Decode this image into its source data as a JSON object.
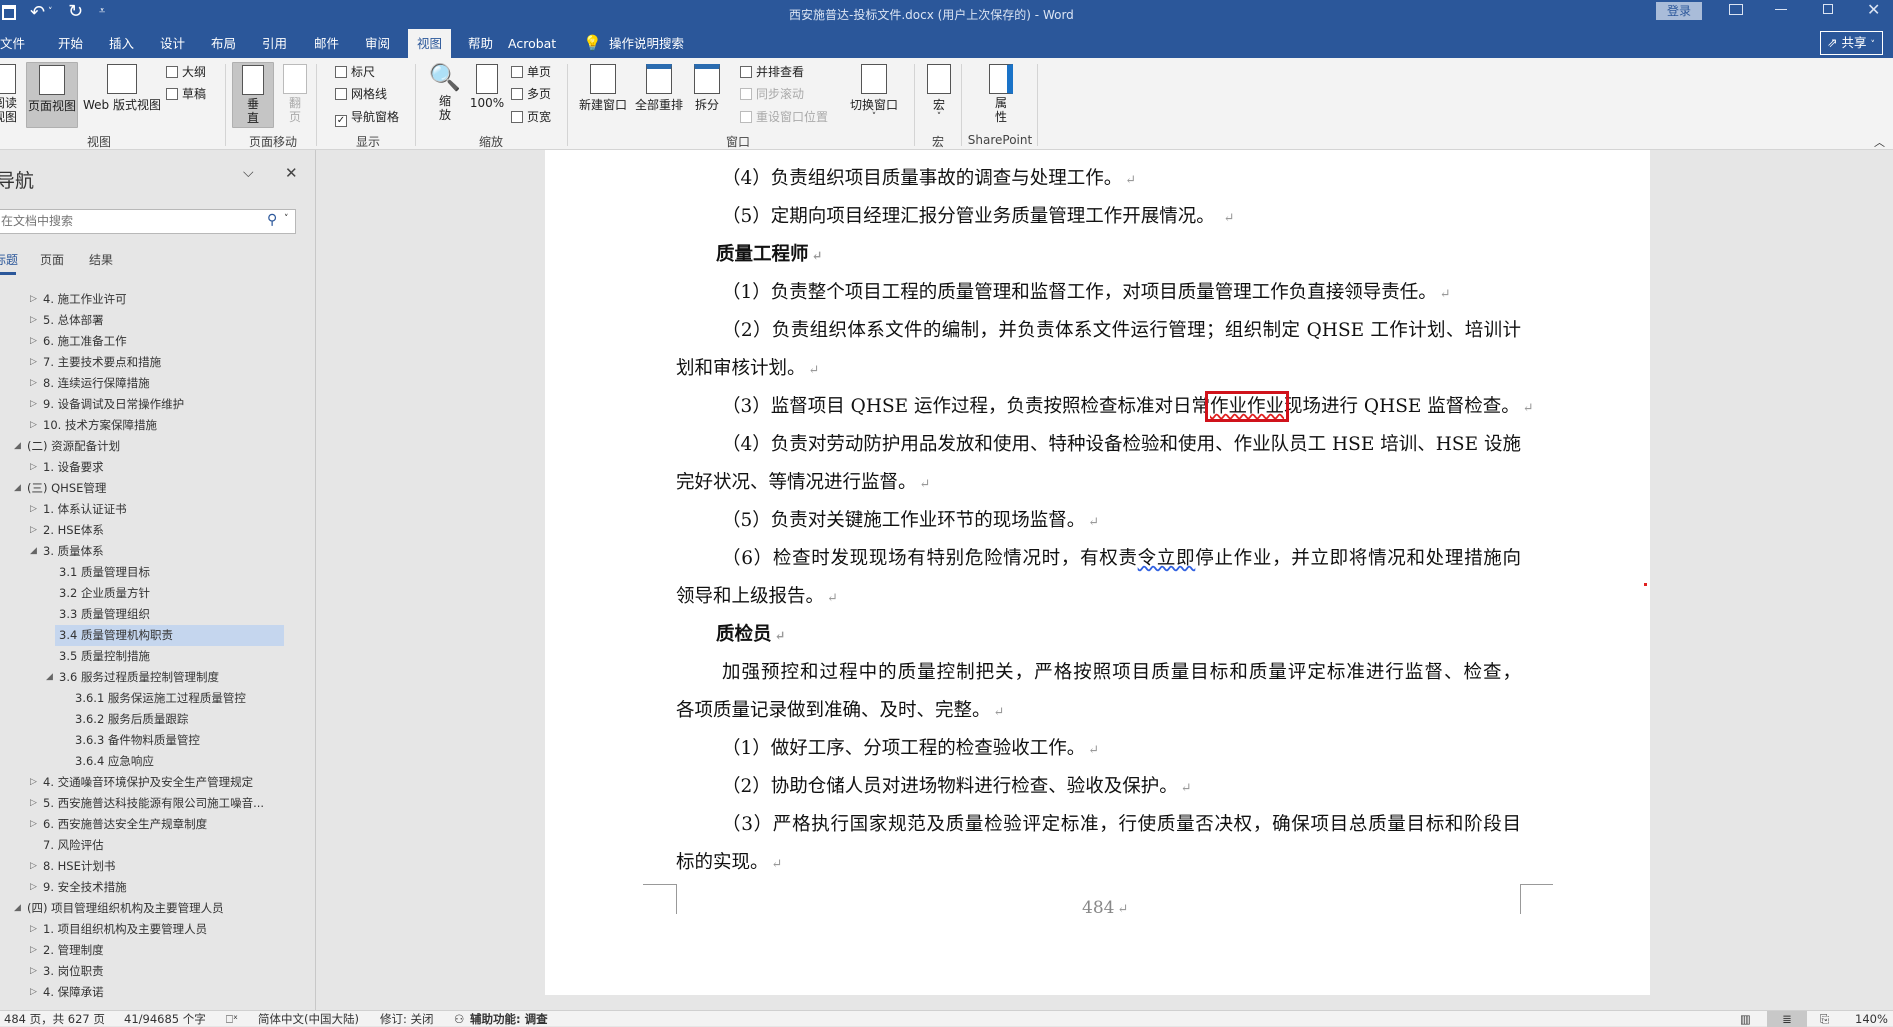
{
  "titlebar": {
    "title": "西安施普达-投标文件.docx (用户上次保存的) - Word",
    "signin": "登录",
    "share": "共享"
  },
  "tabs": [
    "文件",
    "开始",
    "插入",
    "设计",
    "布局",
    "引用",
    "邮件",
    "审阅",
    "视图",
    "帮助",
    "Acrobat"
  ],
  "active_tab": "视图",
  "tell_me": "操作说明搜索",
  "ribbon": {
    "read_view": "阅读视图",
    "print_layout": "页面视图",
    "web_layout": "Web 版式视图",
    "outline": "大纲",
    "draft": "草稿",
    "vertical": "垂直",
    "side_to_side": "翻页",
    "ruler": "标尺",
    "gridlines": "网格线",
    "nav_pane": "导航窗格",
    "zoom": "缩放",
    "zoom100": "100%",
    "one_page": "单页",
    "multi_page": "多页",
    "page_width": "页宽",
    "new_window": "新建窗口",
    "arrange_all": "全部重排",
    "split": "拆分",
    "side_by_side": "并排查看",
    "sync_scroll": "同步滚动",
    "reset_pos": "重设窗口位置",
    "switch_windows": "切换窗口",
    "macros": "宏",
    "properties": "属性",
    "groups": {
      "views": "视图",
      "page_movement": "页面移动",
      "show": "显示",
      "zoom": "缩放",
      "window": "窗口",
      "macros": "宏",
      "sharepoint": "SharePoint"
    },
    "checks": {
      "ruler": false,
      "gridlines": false,
      "nav_pane": true
    }
  },
  "nav": {
    "title": "导航",
    "search_placeholder": "在文档中搜索",
    "tabs": [
      "标题",
      "页面",
      "结果"
    ],
    "items": [
      {
        "text": "4. 施工作业许可",
        "level": 1,
        "state": "collapsed"
      },
      {
        "text": "5. 总体部署",
        "level": 1,
        "state": "collapsed"
      },
      {
        "text": "6. 施工准备工作",
        "level": 1,
        "state": "collapsed"
      },
      {
        "text": "7. 主要技术要点和措施",
        "level": 1,
        "state": "collapsed"
      },
      {
        "text": "8. 连续运行保障措施",
        "level": 1,
        "state": "collapsed"
      },
      {
        "text": "9. 设备调试及日常操作维护",
        "level": 1,
        "state": "collapsed"
      },
      {
        "text": "10. 技术方案保障措施",
        "level": 1,
        "state": "collapsed"
      },
      {
        "text": "(二) 资源配备计划",
        "level": 0,
        "state": "expanded"
      },
      {
        "text": "1. 设备要求",
        "level": 1,
        "state": "collapsed"
      },
      {
        "text": "(三) QHSE管理",
        "level": 0,
        "state": "expanded"
      },
      {
        "text": "1. 体系认证证书",
        "level": 1,
        "state": "collapsed"
      },
      {
        "text": "2. HSE体系",
        "level": 1,
        "state": "collapsed"
      },
      {
        "text": "3. 质量体系",
        "level": 1,
        "state": "expanded"
      },
      {
        "text": "3.1 质量管理目标",
        "level": 2,
        "state": "none"
      },
      {
        "text": "3.2 企业质量方针",
        "level": 2,
        "state": "none"
      },
      {
        "text": "3.3 质量管理组织",
        "level": 2,
        "state": "none"
      },
      {
        "text": "3.4 质量管理机构职责",
        "level": 2,
        "state": "none",
        "selected": true
      },
      {
        "text": "3.5 质量控制措施",
        "level": 2,
        "state": "none"
      },
      {
        "text": "3.6 服务过程质量控制管理制度",
        "level": 2,
        "state": "expanded"
      },
      {
        "text": "3.6.1 服务保运施工过程质量管控",
        "level": 3,
        "state": "none"
      },
      {
        "text": "3.6.2 服务后质量跟踪",
        "level": 3,
        "state": "none"
      },
      {
        "text": "3.6.3 备件物料质量管控",
        "level": 3,
        "state": "none"
      },
      {
        "text": "3.6.4 应急响应",
        "level": 3,
        "state": "none"
      },
      {
        "text": "4. 交通噪音环境保护及安全生产管理规定",
        "level": 1,
        "state": "collapsed"
      },
      {
        "text": "5. 西安施普达科技能源有限公司施工噪音...",
        "level": 1,
        "state": "collapsed"
      },
      {
        "text": "6. 西安施普达安全生产规章制度",
        "level": 1,
        "state": "collapsed"
      },
      {
        "text": "7. 风险评估",
        "level": 1,
        "state": "none"
      },
      {
        "text": "8. HSE计划书",
        "level": 1,
        "state": "collapsed"
      },
      {
        "text": "9. 安全技术措施",
        "level": 1,
        "state": "collapsed"
      },
      {
        "text": "(四) 项目管理组织机构及主要管理人员",
        "level": 0,
        "state": "expanded"
      },
      {
        "text": "1. 项目组织机构及主要管理人员",
        "level": 1,
        "state": "collapsed"
      },
      {
        "text": "2. 管理制度",
        "level": 1,
        "state": "collapsed"
      },
      {
        "text": "3. 岗位职责",
        "level": 1,
        "state": "collapsed"
      },
      {
        "text": "4. 保障承诺",
        "level": 1,
        "state": "collapsed"
      }
    ]
  },
  "document": {
    "lines": [
      {
        "text": "（4）负责组织项目质量事故的调查与处理工作。",
        "first": true,
        "last": true
      },
      {
        "text": "（5）定期向项目经理汇报分管业务质量管理工作开展情况。 ",
        "first": true,
        "last": true
      },
      {
        "text": "质量工程师",
        "first": true,
        "last": true,
        "bold": true
      },
      {
        "text": "（1）负责整个项目工程的质量管理和监督工作，对项目质量管理工作负直接领导责任。",
        "first": true,
        "last": true
      },
      {
        "text": "（2）负责组织体系文件的编制，并负责体系文件运行管理；组织制定 QHSE 工作计划、培训计",
        "first": true,
        "last": false
      },
      {
        "text": "划和审核计划。",
        "first": false,
        "last": true
      },
      {
        "parts": [
          "（3）监督项目 QHSE 运作过程，负责按照检查标准对日常",
          "作业作业",
          "现场进行 QHSE 监督检查。"
        ],
        "first": true,
        "last": true,
        "mark": "red"
      },
      {
        "text": "（4）负责对劳动防护用品发放和使用、特种设备检验和使用、作业队员工 HSE 培训、HSE 设施",
        "first": true,
        "last": false
      },
      {
        "text": "完好状况、等情况进行监督。",
        "first": false,
        "last": true
      },
      {
        "text": "（5）负责对关键施工作业环节的现场监督。",
        "first": true,
        "last": true
      },
      {
        "parts": [
          "（6）检查时发现现场有特别危险情况时，有权责",
          "令立即",
          "停止作业，并立即将情况和处理措施向"
        ],
        "first": true,
        "last": false,
        "mark": "blue"
      },
      {
        "text": "领导和上级报告。",
        "first": false,
        "last": true
      },
      {
        "text": "质检员",
        "first": true,
        "last": true,
        "bold": true
      },
      {
        "text": "加强预控和过程中的质量控制把关，严格按照项目质量目标和质量评定标准进行监督、检查，",
        "first": true,
        "last": false
      },
      {
        "text": "各项质量记录做到准确、及时、完整。",
        "first": false,
        "last": true
      },
      {
        "text": "（1）做好工序、分项工程的检查验收工作。",
        "first": true,
        "last": true
      },
      {
        "text": "（2）协助仓储人员对进场物料进行检查、验收及保护。",
        "first": true,
        "last": true
      },
      {
        "text": "（3）严格执行国家规范及质量检验评定标准，行使质量否决权，确保项目总质量目标和阶段目",
        "first": true,
        "last": false
      },
      {
        "text": "标的实现。",
        "first": false,
        "last": true
      }
    ],
    "paragraph_mark": "↵",
    "page_number": "484"
  },
  "status": {
    "page": "484 页，共 627 页",
    "words": "41/94685 个字",
    "language": "简体中文(中国大陆)",
    "track_changes": "修订: 关闭",
    "accessibility": "辅助功能: 调查",
    "zoom": "140%"
  },
  "colors": {
    "brand": "#2b579a",
    "highlight": "#c5d6ee",
    "red_box": "#d0121b"
  }
}
